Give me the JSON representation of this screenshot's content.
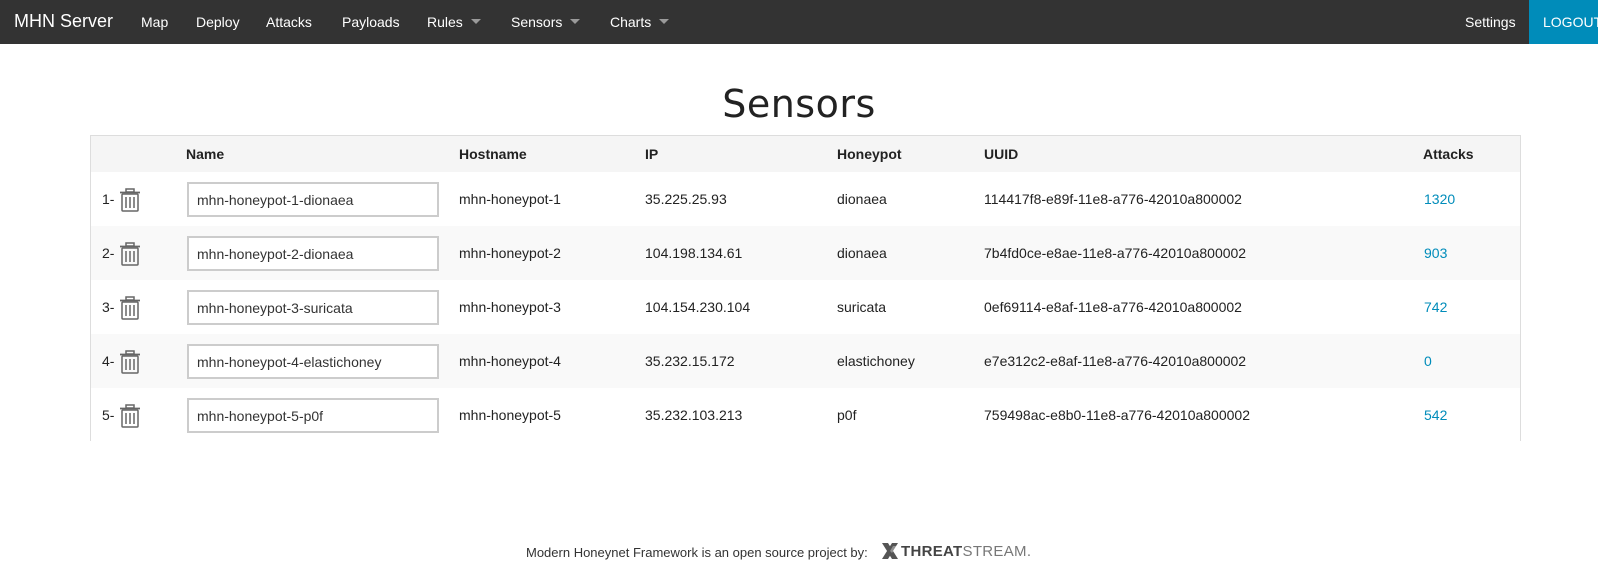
{
  "navbar": {
    "brand": "MHN Server",
    "items": [
      {
        "label": "Map",
        "dropdown": false
      },
      {
        "label": "Deploy",
        "dropdown": false
      },
      {
        "label": "Attacks",
        "dropdown": false
      },
      {
        "label": "Payloads",
        "dropdown": false
      },
      {
        "label": "Rules",
        "dropdown": true
      },
      {
        "label": "Sensors",
        "dropdown": true
      },
      {
        "label": "Charts",
        "dropdown": true
      }
    ],
    "settings": "Settings",
    "logout": "LOGOUT",
    "bar_color": "#333333",
    "accent_color": "#008cba"
  },
  "page": {
    "title": "Sensors"
  },
  "table": {
    "columns": [
      "Name",
      "Hostname",
      "IP",
      "Honeypot",
      "UUID",
      "Attacks"
    ],
    "rows": [
      {
        "index": "1-",
        "name": "mhn-honeypot-1-dionaea",
        "hostname": "mhn-honeypot-1",
        "ip": "35.225.25.93",
        "honeypot": "dionaea",
        "uuid": "114417f8-e89f-11e8-a776-42010a800002",
        "attacks": "1320"
      },
      {
        "index": "2-",
        "name": "mhn-honeypot-2-dionaea",
        "hostname": "mhn-honeypot-2",
        "ip": "104.198.134.61",
        "honeypot": "dionaea",
        "uuid": "7b4fd0ce-e8ae-11e8-a776-42010a800002",
        "attacks": "903"
      },
      {
        "index": "3-",
        "name": "mhn-honeypot-3-suricata",
        "hostname": "mhn-honeypot-3",
        "ip": "104.154.230.104",
        "honeypot": "suricata",
        "uuid": "0ef69114-e8af-11e8-a776-42010a800002",
        "attacks": "742"
      },
      {
        "index": "4-",
        "name": "mhn-honeypot-4-elastichoney",
        "hostname": "mhn-honeypot-4",
        "ip": "35.232.15.172",
        "honeypot": "elastichoney",
        "uuid": "e7e312c2-e8af-11e8-a776-42010a800002",
        "attacks": "0"
      },
      {
        "index": "5-",
        "name": "mhn-honeypot-5-p0f",
        "hostname": "mhn-honeypot-5",
        "ip": "35.232.103.213",
        "honeypot": "p0f",
        "uuid": "759498ac-e8b0-11e8-a776-42010a800002",
        "attacks": "542"
      }
    ],
    "row_icon": "trash-icon",
    "link_color": "#008cba"
  },
  "footer": {
    "text": "Modern Honeynet Framework is an open source project by:",
    "logo_bold": "THREAT",
    "logo_light": "STREAM."
  }
}
